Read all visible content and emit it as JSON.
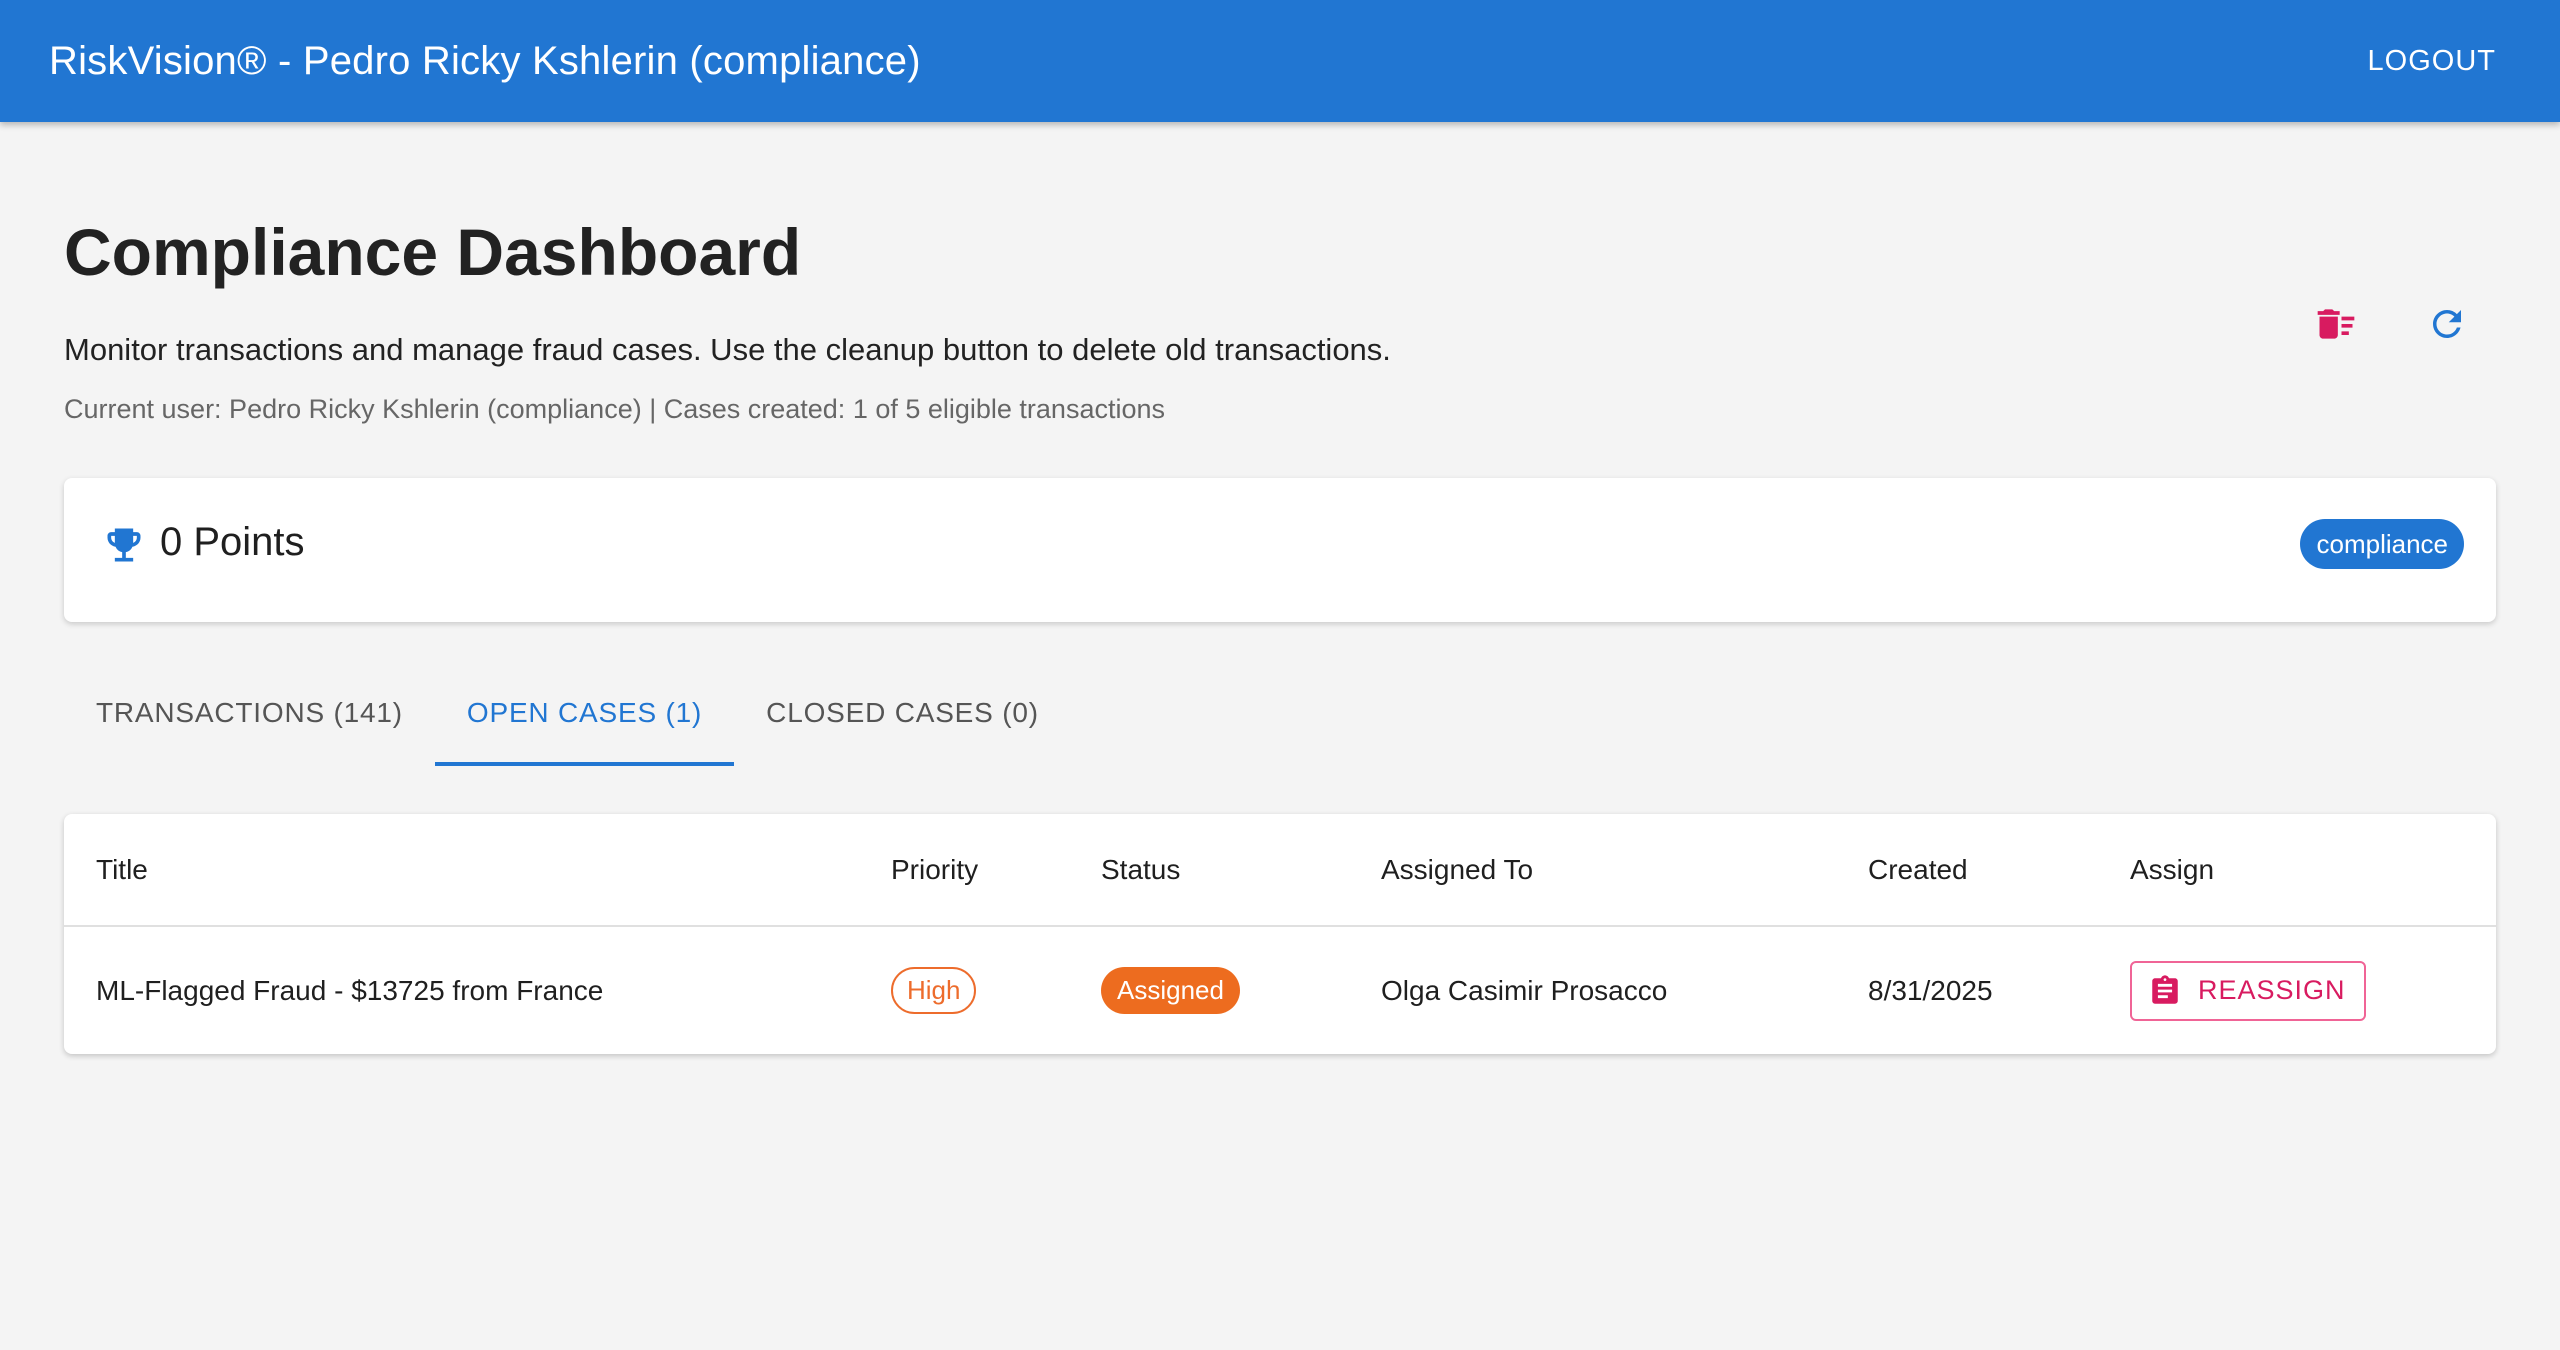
{
  "appbar": {
    "title": "RiskVision® - Pedro Ricky Kshlerin (compliance)",
    "logout_label": "LOGOUT"
  },
  "header": {
    "title": "Compliance Dashboard",
    "description": "Monitor transactions and manage fraud cases. Use the cleanup button to delete old transactions.",
    "meta": "Current user: Pedro Ricky Kshlerin (compliance) | Cases created: 1 of 5 eligible transactions"
  },
  "actions": {
    "cleanup_icon": "delete-sweep-icon",
    "refresh_icon": "refresh-icon"
  },
  "points": {
    "icon": "trophy-icon",
    "text": "0 Points",
    "role": "compliance"
  },
  "tabs": [
    {
      "label": "TRANSACTIONS (141)",
      "active": false
    },
    {
      "label": "OPEN CASES (1)",
      "active": true
    },
    {
      "label": "CLOSED CASES (0)",
      "active": false
    }
  ],
  "table": {
    "columns": [
      "Title",
      "Priority",
      "Status",
      "Assigned To",
      "Created",
      "Assign"
    ],
    "rows": [
      {
        "title": "ML-Flagged Fraud - $13725 from France",
        "priority": "High",
        "status": "Assigned",
        "assigned_to": "Olga Casimir Prosacco",
        "created": "8/31/2025",
        "action": "REASSIGN"
      }
    ]
  },
  "colors": {
    "primary": "#2176d2",
    "danger": "#d81b60",
    "warning": "#ed6c2c",
    "background": "#f4f4f4"
  }
}
